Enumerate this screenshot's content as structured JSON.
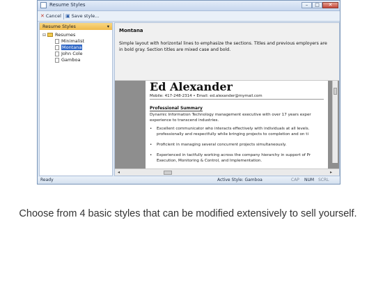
{
  "window": {
    "title": "Resume Styles",
    "controls": {
      "minimize": "–",
      "maximize": "□",
      "close": "✕"
    }
  },
  "toolbar": {
    "cancel_label": "Cancel",
    "save_label": "Save style..."
  },
  "sidebar": {
    "header": "Resume Styles",
    "pin": "▾",
    "root": "Resumes",
    "items": [
      {
        "label": "Minimalist"
      },
      {
        "label": "Montana"
      },
      {
        "label": "John Cole"
      },
      {
        "label": "Gamboa"
      }
    ]
  },
  "detail": {
    "title": "Montana",
    "description_lines": [
      "Simple layout with horizontal lines to emphasize the sections.  Titles and previous employers are",
      "in bold gray.  Section titles are mixed case and bold."
    ]
  },
  "preview": {
    "name": "Ed Alexander",
    "contact": "Mobile: 417-248-2314 • Email: ed.alexander@mymail.com",
    "section_title": "Professional Summary",
    "summary_lines": [
      "Dynamic Information Technology management executive with over 17 years exper",
      "experience to transcend industries."
    ],
    "bullets": [
      [
        "Excellent communicator who interacts effectively with individuals at all levels.",
        "professionally and respectfully while bringing projects to completion and on ti"
      ],
      [
        "Proficient in managing several concurrent projects simultaneously."
      ],
      [
        "Experienced in tactfully working across the company hierarchy in support of Pr",
        "Execution, Monitoring & Control, and Implementation."
      ]
    ]
  },
  "statusbar": {
    "ready": "Ready",
    "active_style": "Active Style: Gamboa",
    "cap": "CAP",
    "num": "NUM",
    "scrl": "SCRL"
  },
  "caption": "Choose from 4 basic styles that can be modified extensively to sell yourself."
}
